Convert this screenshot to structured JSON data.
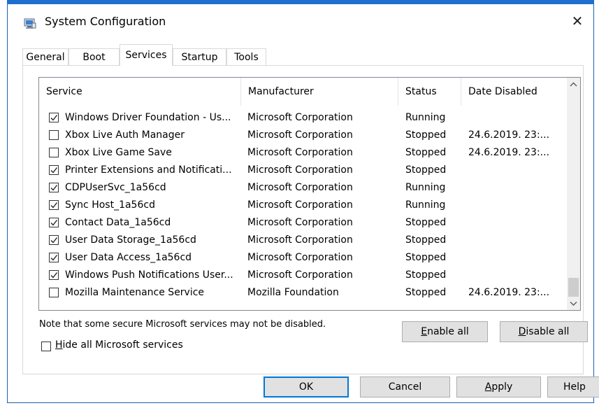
{
  "window": {
    "title": "System Configuration",
    "close_glyph": "✕"
  },
  "tabs": [
    {
      "label": "General",
      "active": false
    },
    {
      "label": "Boot",
      "active": false
    },
    {
      "label": "Services",
      "active": true
    },
    {
      "label": "Startup",
      "active": false
    },
    {
      "label": "Tools",
      "active": false
    }
  ],
  "table": {
    "columns": [
      "Service",
      "Manufacturer",
      "Status",
      "Date Disabled"
    ],
    "rows": [
      {
        "checked": true,
        "service": "Windows Driver Foundation - Us...",
        "manufacturer": "Microsoft Corporation",
        "status": "Running",
        "date": ""
      },
      {
        "checked": false,
        "service": "Xbox Live Auth Manager",
        "manufacturer": "Microsoft Corporation",
        "status": "Stopped",
        "date": "24.6.2019. 23:..."
      },
      {
        "checked": false,
        "service": "Xbox Live Game Save",
        "manufacturer": "Microsoft Corporation",
        "status": "Stopped",
        "date": "24.6.2019. 23:..."
      },
      {
        "checked": true,
        "service": "Printer Extensions and Notificati...",
        "manufacturer": "Microsoft Corporation",
        "status": "Stopped",
        "date": ""
      },
      {
        "checked": true,
        "service": "CDPUserSvc_1a56cd",
        "manufacturer": "Microsoft Corporation",
        "status": "Running",
        "date": ""
      },
      {
        "checked": true,
        "service": "Sync Host_1a56cd",
        "manufacturer": "Microsoft Corporation",
        "status": "Running",
        "date": ""
      },
      {
        "checked": true,
        "service": "Contact Data_1a56cd",
        "manufacturer": "Microsoft Corporation",
        "status": "Stopped",
        "date": ""
      },
      {
        "checked": true,
        "service": "User Data Storage_1a56cd",
        "manufacturer": "Microsoft Corporation",
        "status": "Stopped",
        "date": ""
      },
      {
        "checked": true,
        "service": "User Data Access_1a56cd",
        "manufacturer": "Microsoft Corporation",
        "status": "Stopped",
        "date": ""
      },
      {
        "checked": true,
        "service": "Windows Push Notifications User...",
        "manufacturer": "Microsoft Corporation",
        "status": "Stopped",
        "date": ""
      },
      {
        "checked": false,
        "service": "Mozilla Maintenance Service",
        "manufacturer": "Mozilla Foundation",
        "status": "Stopped",
        "date": "24.6.2019. 23:..."
      }
    ]
  },
  "note": "Note that some secure Microsoft services may not be disabled.",
  "enable_all": {
    "underline": "E",
    "rest": "nable all"
  },
  "disable_all": {
    "underline": "D",
    "rest": "isable all"
  },
  "hide_ms": {
    "checked": false,
    "underline": "H",
    "rest": "ide all Microsoft services"
  },
  "buttons": {
    "ok": "OK",
    "cancel": "Cancel",
    "apply": {
      "underline": "A",
      "rest": "pply"
    },
    "help": "Help"
  },
  "icons": {
    "app": "system-configuration-icon",
    "close": "close-icon",
    "scroll_up": "chevron-up-icon",
    "scroll_down": "chevron-down-icon"
  },
  "colors": {
    "title_accent": "#1e6fd0",
    "default_button_border": "#0078d7"
  }
}
